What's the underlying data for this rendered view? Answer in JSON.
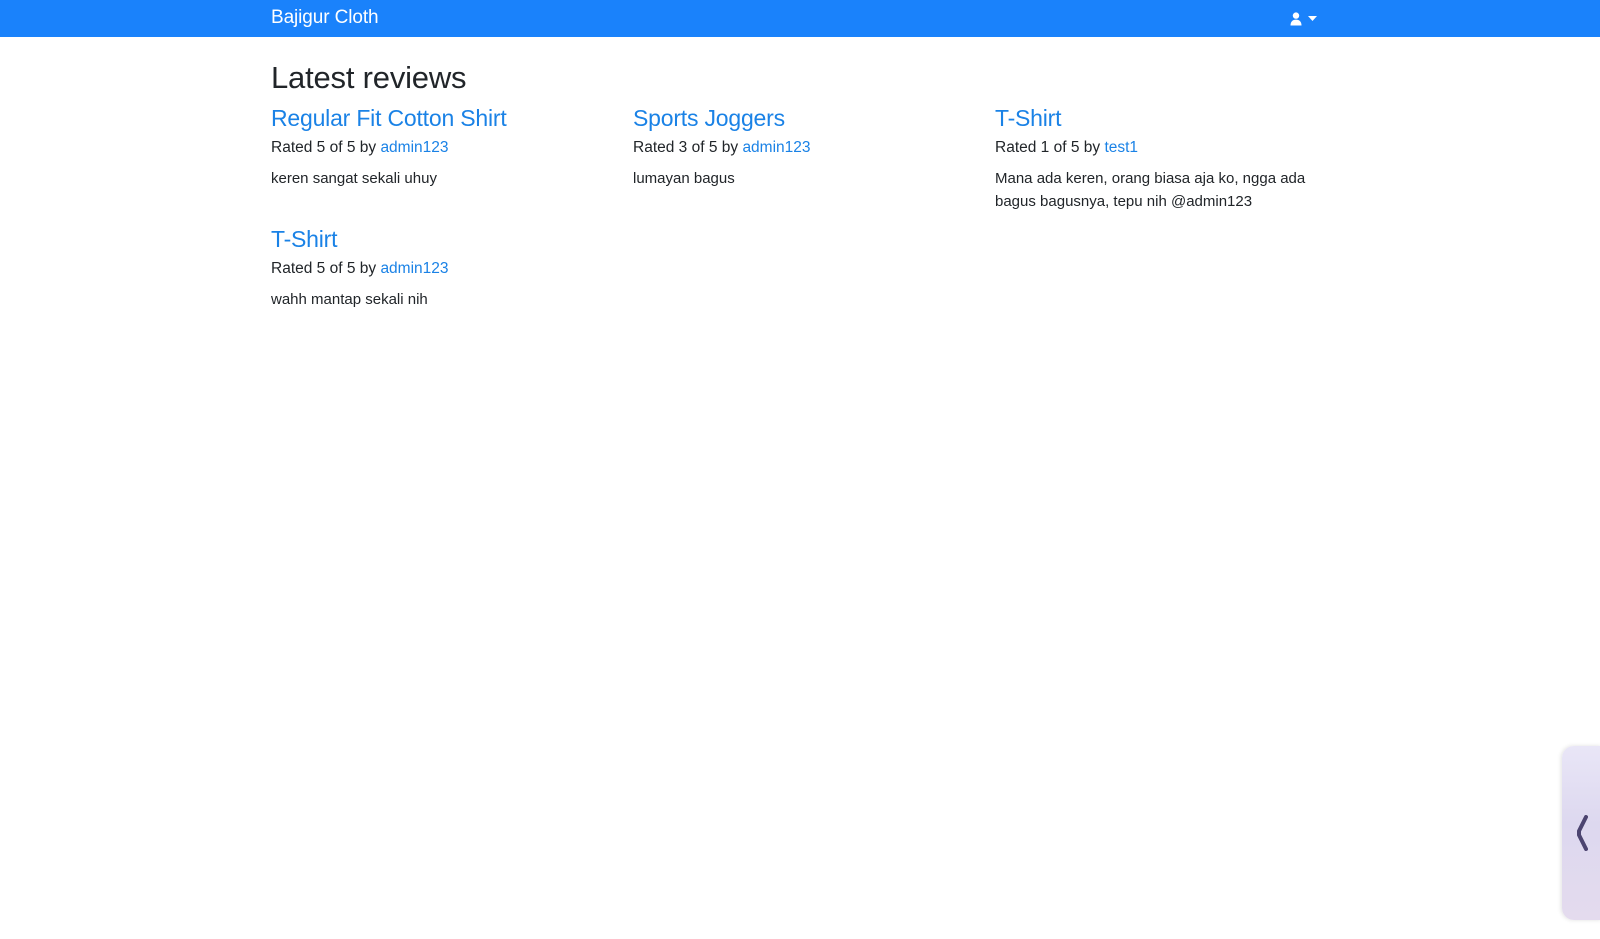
{
  "navbar": {
    "brand": "Bajigur Cloth",
    "user_icon": "user-icon",
    "caret_icon": "caret-down-icon",
    "background": "#1a82fb"
  },
  "main": {
    "title": "Latest reviews",
    "reviews": [
      {
        "product": "Regular Fit Cotton Shirt",
        "rating_text": "Rated 5 of 5 by",
        "author": "admin123",
        "text": "keren sangat sekali uhuy"
      },
      {
        "product": "Sports Joggers",
        "rating_text": "Rated 3 of 5 by",
        "author": "admin123",
        "text": "lumayan bagus"
      },
      {
        "product": "T-Shirt",
        "rating_text": "Rated 1 of 5 by",
        "author": "test1",
        "text": "Mana ada keren, orang biasa aja ko, ngga ada bagus bagusnya, tepu nih @admin123"
      },
      {
        "product": "T-Shirt",
        "rating_text": "Rated 5 of 5 by",
        "author": "admin123",
        "text": "wahh mantap sekali nih"
      }
    ]
  },
  "side_widget": {
    "icon": "chevron-left-icon"
  },
  "colors": {
    "link": "#1a82e6",
    "text": "#212529"
  }
}
